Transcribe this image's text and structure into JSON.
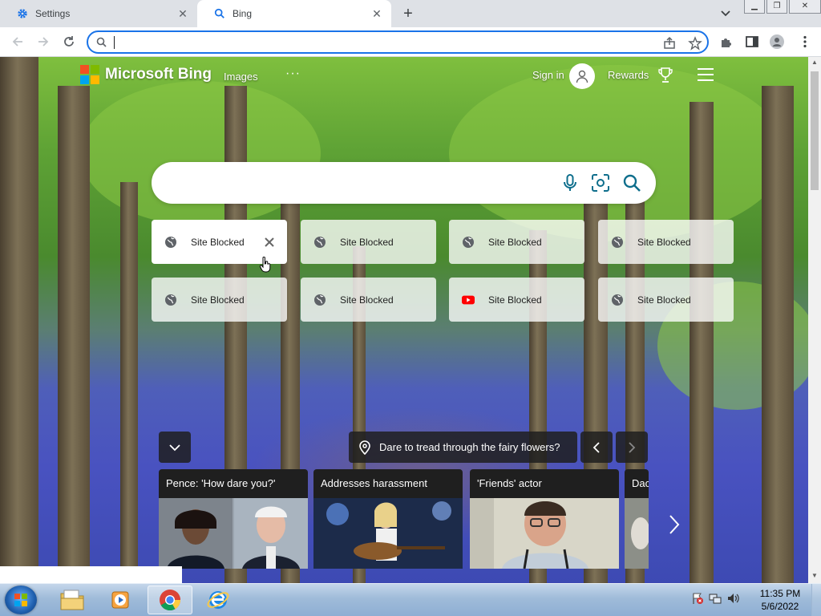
{
  "browser": {
    "tabs": [
      {
        "title": "Settings",
        "icon": "gear-icon",
        "active": false
      },
      {
        "title": "Bing",
        "icon": "search-icon",
        "active": true
      }
    ],
    "new_tab_symbol": "+",
    "address": {
      "value": "",
      "placeholder": ""
    }
  },
  "bing": {
    "brand": "Microsoft Bing",
    "nav": {
      "images": "Images",
      "more": "···"
    },
    "sign_in": "Sign in",
    "rewards": "Rewards",
    "search": {
      "value": "",
      "placeholder": ""
    },
    "tiles": [
      {
        "label": "Site Blocked",
        "icon": "globe-icon"
      },
      {
        "label": "Site Blocked",
        "icon": "globe-icon"
      },
      {
        "label": "Site Blocked",
        "icon": "globe-icon"
      },
      {
        "label": "Site Blocked",
        "icon": "globe-icon"
      },
      {
        "label": "Site Blocked",
        "icon": "globe-icon"
      },
      {
        "label": "Site Blocked",
        "icon": "globe-icon"
      },
      {
        "label": "Site Blocked",
        "icon": "youtube-icon"
      },
      {
        "label": "Site Blocked",
        "icon": "globe-icon"
      }
    ],
    "image_caption": "Dare to tread through the fairy flowers?",
    "news": [
      {
        "headline": "Pence: 'How dare you?'"
      },
      {
        "headline": "Addresses harassment"
      },
      {
        "headline": "'Friends' actor"
      },
      {
        "headline": "Dac"
      }
    ]
  },
  "colors": {
    "ms_red": "#f25022",
    "ms_green": "#7fba00",
    "ms_blue": "#00a4ef",
    "ms_yellow": "#ffb900",
    "bing_teal": "#0e6e8c",
    "chrome_blue": "#1a73e8"
  },
  "taskbar": {
    "time": "11:35 PM",
    "date": "5/6/2022"
  }
}
